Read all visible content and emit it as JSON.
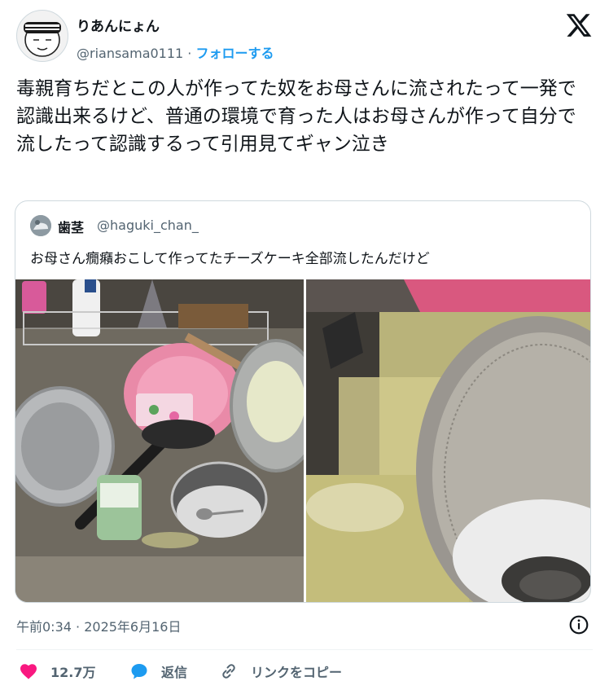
{
  "author": {
    "name": "りあんにょん",
    "handle": "@riansama0111",
    "separator": " · ",
    "follow_label": "フォローする"
  },
  "tweet": {
    "text": "毒親育ちだとこの人が作ってた奴をお母さんに流されたって一発で認識出来るけど、普通の環境で育った人はお母さんが作って自分で流したって認識するって引用見てギャン泣き"
  },
  "quote": {
    "name": "歯茎",
    "handle": "@haguki_chan_",
    "text": "お母さん癇癪おこして作ってたチーズケーキ全部流したんだけど"
  },
  "meta": {
    "time": "午前0:34",
    "separator": " · ",
    "date": "2025年6月16日"
  },
  "actions": {
    "like_count": "12.7万",
    "reply_label": "返信",
    "copy_link_label": "リンクをコピー"
  },
  "colors": {
    "accent": "#1d9bf0",
    "like": "#f91880",
    "muted": "#536471"
  }
}
